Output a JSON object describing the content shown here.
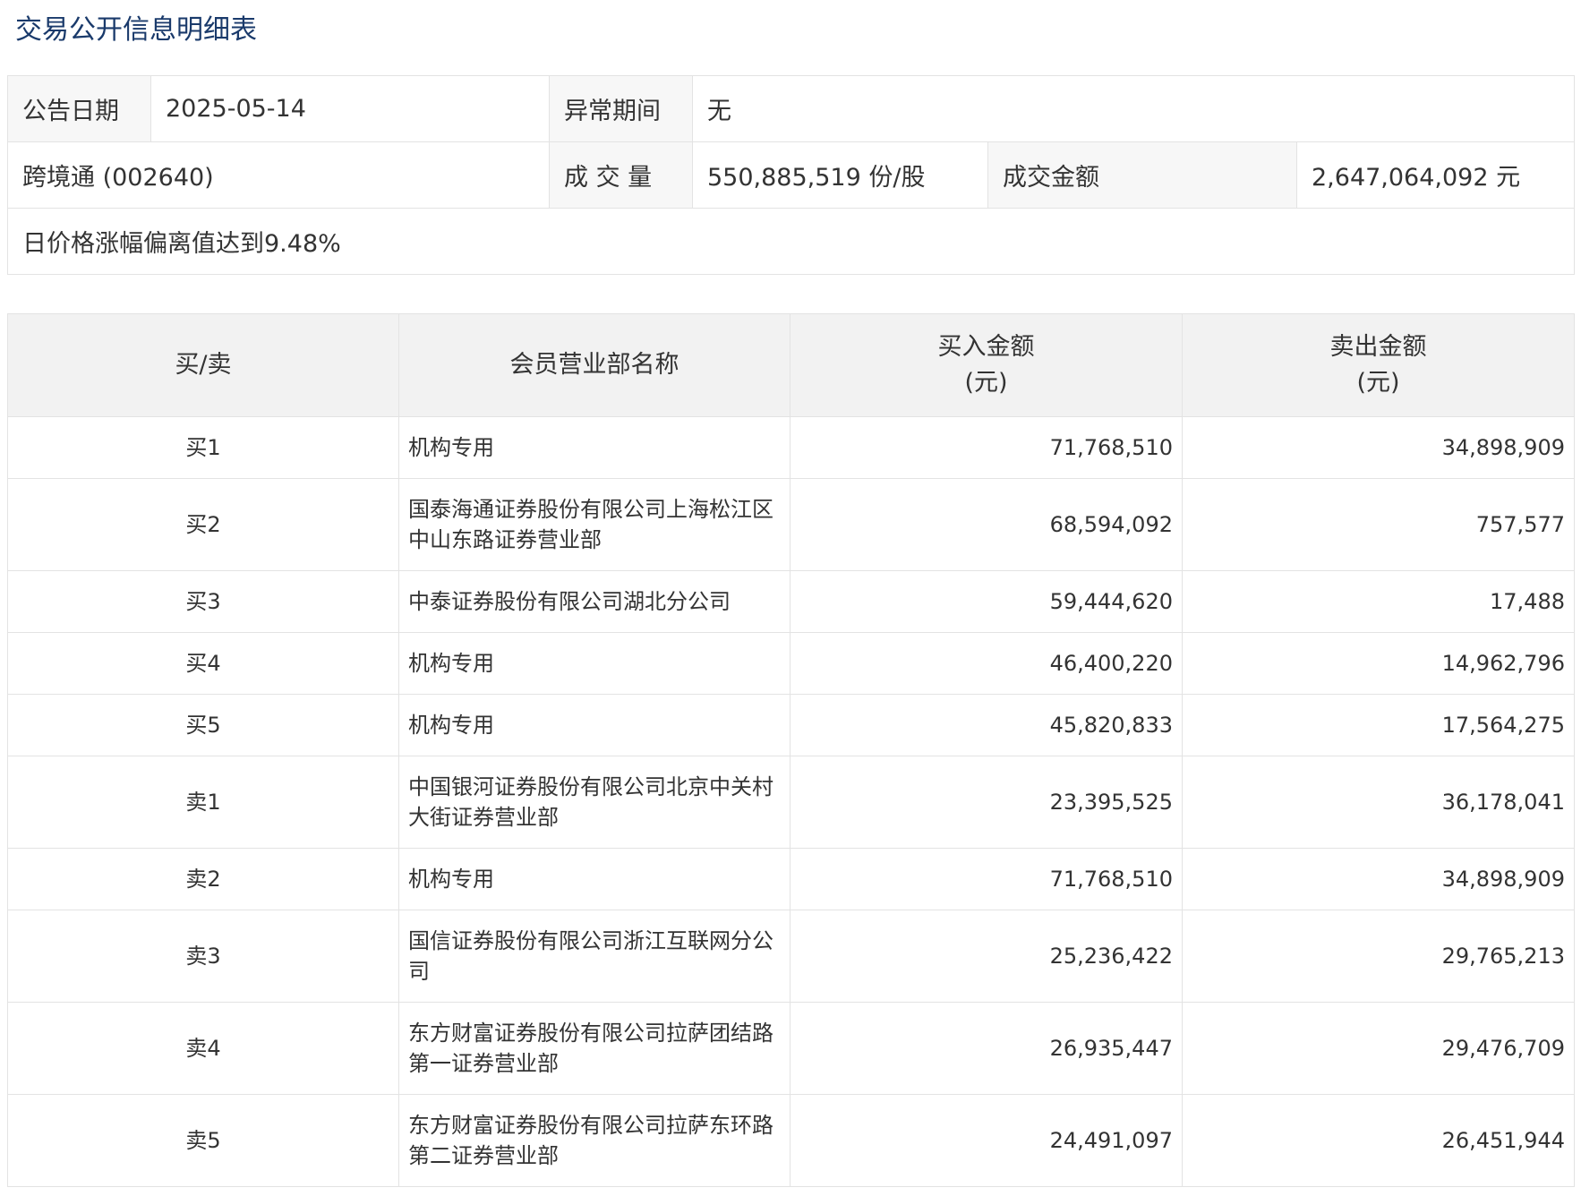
{
  "page_title": "交易公开信息明细表",
  "info": {
    "announce_date_label": "公告日期",
    "announce_date": "2025-05-14",
    "abnormal_period_label": "异常期间",
    "abnormal_period": "无",
    "stock": "跨境通 (002640)",
    "volume_label": "成 交 量",
    "volume": "550,885,519 份/股",
    "amount_label": "成交金额",
    "amount": "2,647,064,092 元",
    "reason": "日价格涨幅偏离值达到9.48%"
  },
  "table": {
    "headers": {
      "side": "买/卖",
      "dept": "会员营业部名称",
      "buy_line1": "买入金额",
      "buy_line2": "(元)",
      "sell_line1": "卖出金额",
      "sell_line2": "(元)"
    },
    "rows": [
      {
        "side": "买1",
        "dept": "机构专用",
        "buy": "71,768,510",
        "sell": "34,898,909"
      },
      {
        "side": "买2",
        "dept": "国泰海通证券股份有限公司上海松江区中山东路证券营业部",
        "buy": "68,594,092",
        "sell": "757,577"
      },
      {
        "side": "买3",
        "dept": "中泰证券股份有限公司湖北分公司",
        "buy": "59,444,620",
        "sell": "17,488"
      },
      {
        "side": "买4",
        "dept": "机构专用",
        "buy": "46,400,220",
        "sell": "14,962,796"
      },
      {
        "side": "买5",
        "dept": "机构专用",
        "buy": "45,820,833",
        "sell": "17,564,275"
      },
      {
        "side": "卖1",
        "dept": "中国银河证券股份有限公司北京中关村大街证券营业部",
        "buy": "23,395,525",
        "sell": "36,178,041"
      },
      {
        "side": "卖2",
        "dept": "机构专用",
        "buy": "71,768,510",
        "sell": "34,898,909"
      },
      {
        "side": "卖3",
        "dept": "国信证券股份有限公司浙江互联网分公司",
        "buy": "25,236,422",
        "sell": "29,765,213"
      },
      {
        "side": "卖4",
        "dept": "东方财富证券股份有限公司拉萨团结路第一证券营业部",
        "buy": "26,935,447",
        "sell": "29,476,709"
      },
      {
        "side": "卖5",
        "dept": "东方财富证券股份有限公司拉萨东环路第二证券营业部",
        "buy": "24,491,097",
        "sell": "26,451,944"
      }
    ]
  }
}
